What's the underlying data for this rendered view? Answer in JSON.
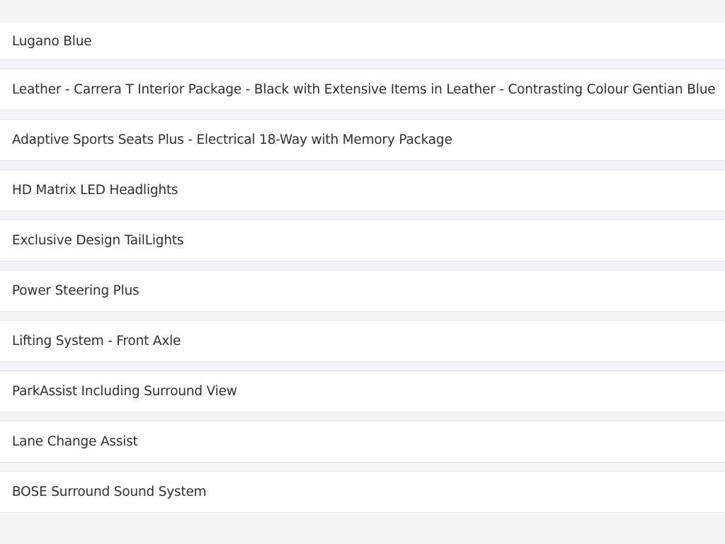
{
  "options": {
    "items": [
      {
        "label": "Lugano Blue"
      },
      {
        "label": "Leather - Carrera T Interior Package - Black with Extensive Items in Leather - Contrasting Colour Gentian Blue"
      },
      {
        "label": "Adaptive Sports Seats Plus - Electrical 18-Way with Memory Package"
      },
      {
        "label": "HD Matrix LED Headlights"
      },
      {
        "label": "Exclusive Design TailLights"
      },
      {
        "label": "Power Steering Plus"
      },
      {
        "label": "Lifting System - Front Axle"
      },
      {
        "label": "ParkAssist Including Surround View"
      },
      {
        "label": "Lane Change Assist"
      },
      {
        "label": "BOSE Surround Sound System"
      }
    ]
  },
  "colors": {
    "page_background": "#f5f5f3",
    "row_background": "#ffffff",
    "row_border": "#e3e6ea",
    "gap_background": "#f1f3f5",
    "text": "#2f3034"
  }
}
